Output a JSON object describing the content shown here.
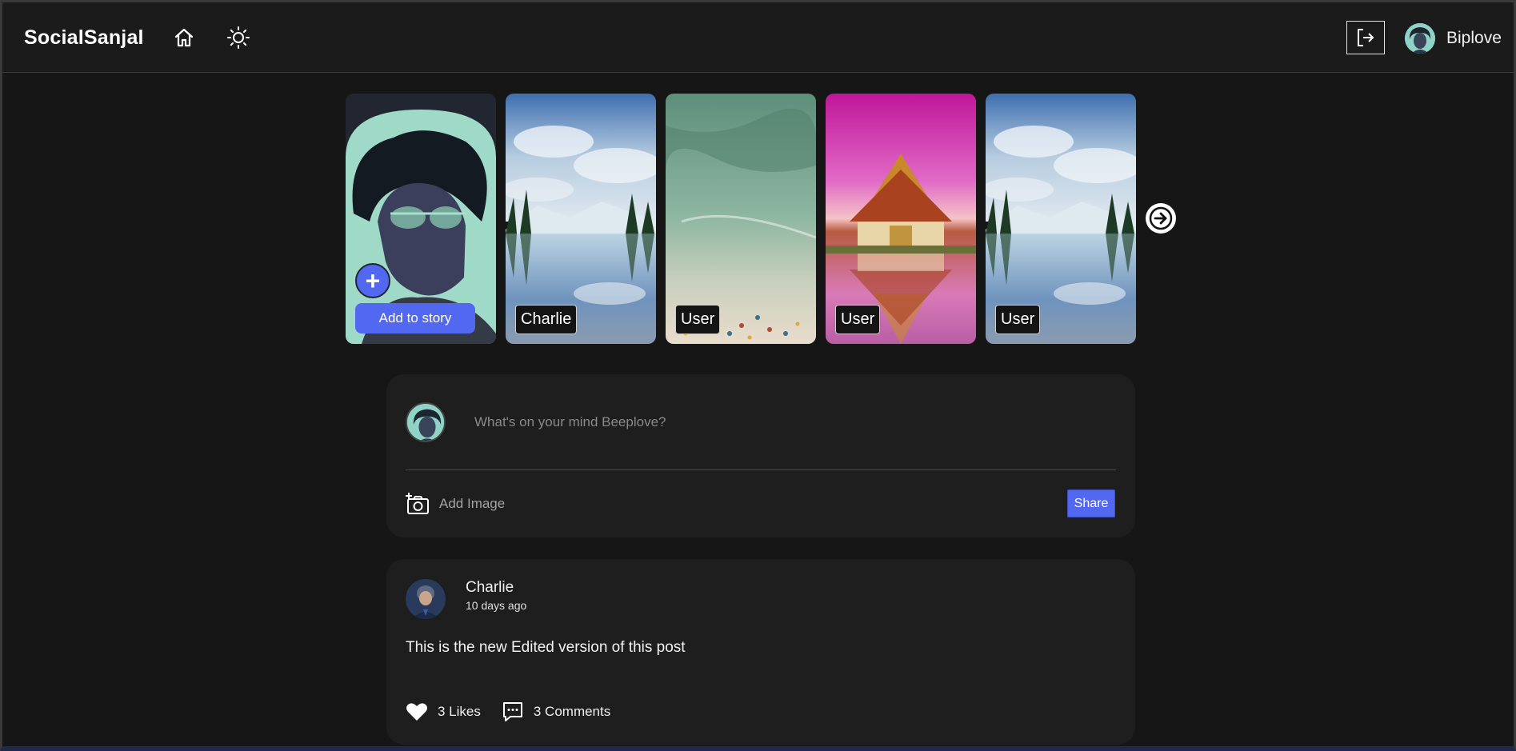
{
  "header": {
    "brand": "SocialSanjal",
    "icons": [
      "home-icon",
      "sun-icon",
      "logout-icon"
    ],
    "user_name": "Biplove"
  },
  "stories": {
    "own": {
      "add_button_label": "Add to story",
      "add_glyph": "+"
    },
    "items": [
      {
        "label": "Charlie"
      },
      {
        "label": "User"
      },
      {
        "label": "User"
      },
      {
        "label": "User"
      }
    ],
    "next_icon": "arrow-right-icon"
  },
  "composer": {
    "placeholder": "What's on your mind Beeplove?",
    "add_image_label": "Add Image",
    "share_label": "Share"
  },
  "post": {
    "author": "Charlie",
    "time": "10 days ago",
    "body": "This is the new Edited version of this post",
    "likes_label": "3 Likes",
    "comments_label": "3 Comments"
  },
  "colors": {
    "background": "#161616",
    "card": "#1e1e1e",
    "accent": "#5368f0"
  }
}
